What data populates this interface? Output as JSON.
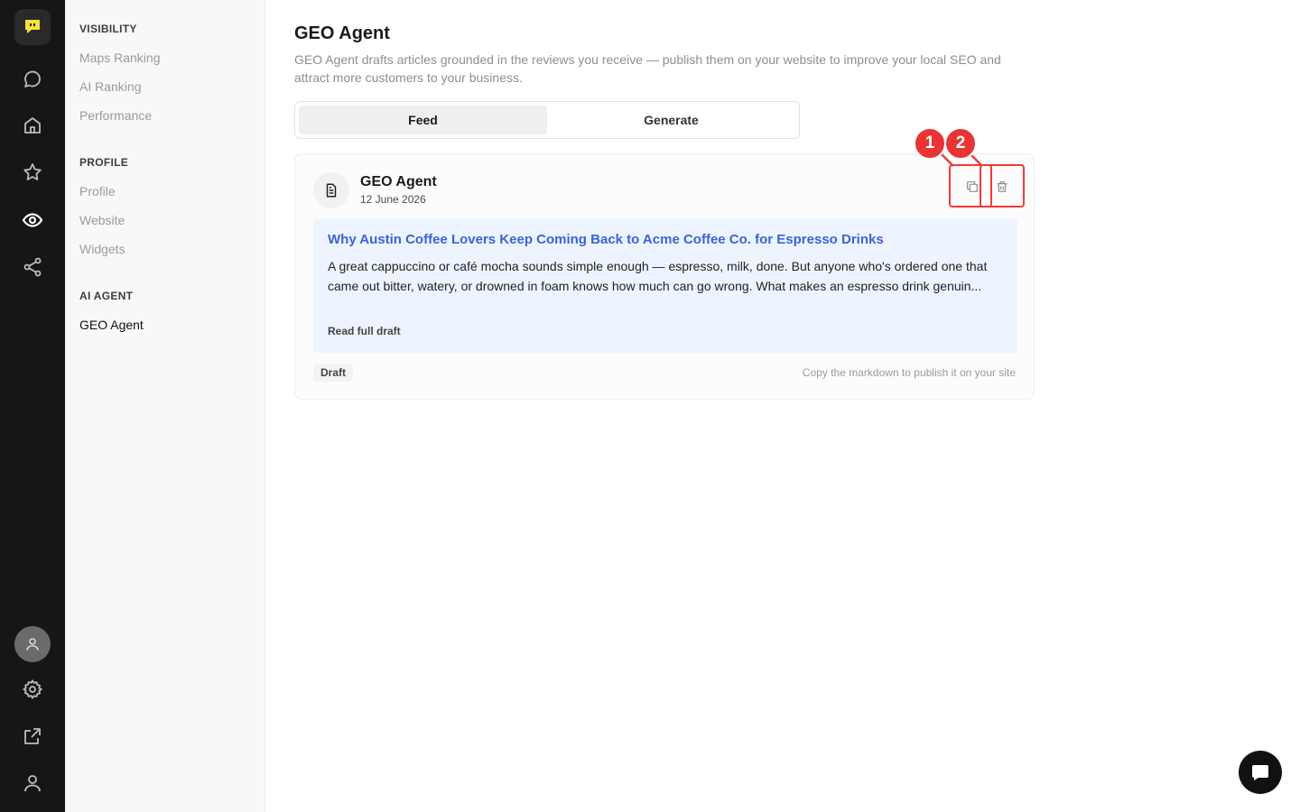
{
  "sidebar": {
    "sections": [
      {
        "heading": "VISIBILITY",
        "items": [
          "Maps Ranking",
          "AI Ranking",
          "Performance"
        ]
      },
      {
        "heading": "PROFILE",
        "items": [
          "Profile",
          "Website",
          "Widgets"
        ]
      },
      {
        "heading": "AI AGENT",
        "items": [
          "GEO Agent"
        ]
      }
    ]
  },
  "page": {
    "title": "GEO Agent",
    "description": "GEO Agent drafts articles grounded in the reviews you receive — publish them on your website to improve your local SEO and attract more customers to your business."
  },
  "tabs": [
    "Feed",
    "Generate"
  ],
  "card": {
    "title": "GEO Agent",
    "date": "12 June 2026",
    "article_title": "Why Austin Coffee Lovers Keep Coming Back to Acme Coffee Co. for Espresso Drinks",
    "article_excerpt": "A great cappuccino or café mocha sounds simple enough — espresso, milk, done. But anyone who's ordered one that came out bitter, watery, or drowned in foam knows how much can go wrong. What makes an espresso drink genuin...",
    "read_more": "Read full draft",
    "status": "Draft",
    "hint": "Copy the markdown to publish it on your site"
  },
  "annotations": [
    "1",
    "2"
  ],
  "colors": {
    "rail_bg": "#161616",
    "logo_accent": "#f5e33a",
    "link_blue": "#3b63d8",
    "excerpt_bg": "#eef4ff",
    "annotation_red": "#e93434"
  }
}
